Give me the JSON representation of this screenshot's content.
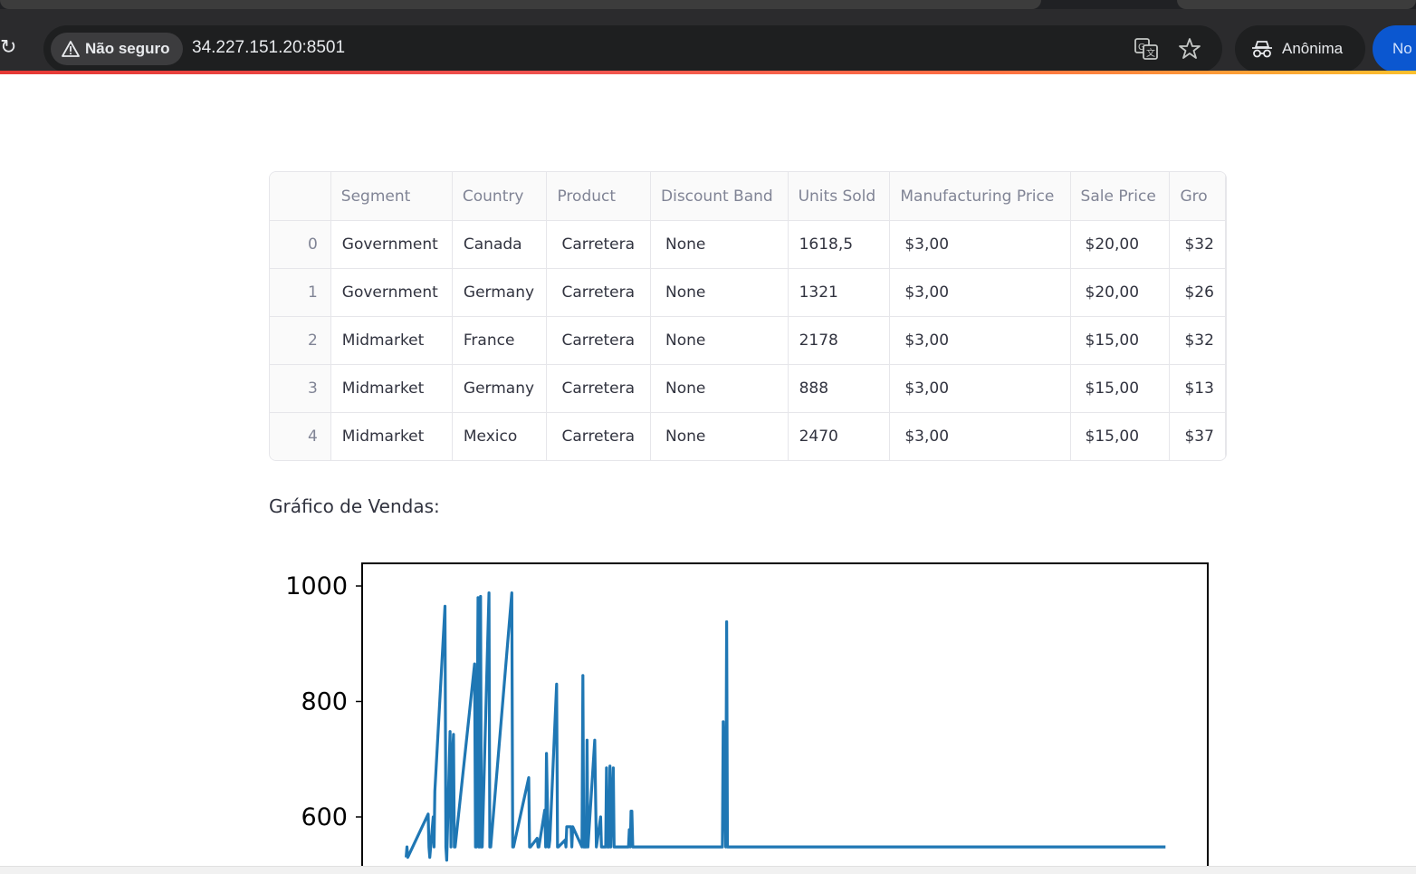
{
  "browser": {
    "security_label": "Não seguro",
    "url": "34.227.151.20:8501",
    "profile_label": "Anônima",
    "new_button_label": "No"
  },
  "table": {
    "columns": [
      "",
      "Segment",
      "Country",
      "Product",
      "Discount Band",
      "Units Sold",
      "Manufacturing Price",
      "Sale Price",
      "Gro"
    ],
    "rows": [
      [
        "0",
        "Government",
        "Canada",
        "Carretera",
        "None",
        "1618,5",
        "$3,00",
        "$20,00",
        "$32"
      ],
      [
        "1",
        "Government",
        "Germany",
        "Carretera",
        "None",
        "1321",
        "$3,00",
        "$20,00",
        "$26"
      ],
      [
        "2",
        "Midmarket",
        "France",
        "Carretera",
        "None",
        "2178",
        "$3,00",
        "$15,00",
        "$32"
      ],
      [
        "3",
        "Midmarket",
        "Germany",
        "Carretera",
        "None",
        "888",
        "$3,00",
        "$15,00",
        "$13"
      ],
      [
        "4",
        "Midmarket",
        "Mexico",
        "Carretera",
        "None",
        "2470",
        "$3,00",
        "$15,00",
        "$37"
      ]
    ]
  },
  "chart_caption": "Gráfico de Vendas:",
  "chart_data": {
    "type": "line",
    "color": "#1f77b4",
    "yticks": [
      600,
      800,
      1000
    ],
    "ylim_visible": [
      548,
      1038
    ],
    "xlim": [
      0,
      100
    ],
    "x": [
      5.2,
      5.3,
      5.4,
      7.8,
      7.9,
      8.0,
      8.4,
      8.5,
      8.6,
      9.8,
      9.9,
      10.0,
      10.4,
      10.5,
      10.6,
      10.8,
      10.9,
      11.0,
      13.3,
      13.4,
      13.5,
      13.7,
      13.8,
      13.9,
      14.0,
      14.1,
      14.2,
      15.0,
      15.1,
      15.2,
      17.7,
      17.8,
      17.9,
      19.7,
      19.8,
      19.9,
      20.7,
      20.8,
      20.9,
      21.6,
      21.7,
      21.8,
      22.0,
      22.1,
      22.2,
      23.0,
      23.1,
      23.2,
      24.0,
      24.1,
      24.2,
      24.7,
      24.8,
      24.9,
      26.0,
      26.1,
      26.2,
      26.5,
      26.6,
      26.7,
      27.5,
      27.6,
      27.7,
      28.2,
      28.3,
      28.4,
      28.8,
      28.9,
      29.0,
      29.2,
      29.3,
      29.4,
      29.7,
      29.8,
      29.9,
      31.5,
      31.6,
      31.7,
      31.8,
      31.9,
      32.0,
      32.1,
      32.2,
      32.3,
      32.4,
      32.5,
      32.6,
      42.5,
      42.6,
      42.7,
      43.0,
      43.1,
      43.2,
      43.3,
      43.4,
      43.5,
      43.6,
      43.7,
      43.8,
      46.0,
      46.1,
      46.2,
      46.3,
      46.4,
      46.5,
      50.8,
      50.9,
      51.0,
      53.2,
      53.3,
      53.4,
      53.7,
      53.8,
      53.9,
      55.5,
      55.6,
      55.7,
      56.2,
      56.3,
      56.4,
      58.0,
      58.1,
      58.2,
      60.0,
      60.1,
      60.2,
      62.0,
      62.1,
      62.2,
      63.6,
      63.7,
      63.8,
      65.0,
      65.1,
      65.2,
      66.5,
      66.6,
      66.7,
      67.2,
      67.3,
      67.4,
      67.7,
      67.8,
      67.9,
      69.3,
      69.4,
      69.5,
      70.8,
      70.9,
      71.0,
      75.1,
      75.2,
      75.3,
      76.0,
      76.1,
      76.2,
      79.0,
      79.1,
      79.2,
      80.4,
      80.5,
      80.6,
      81.6,
      81.7,
      81.8,
      82.1,
      82.2,
      82.3,
      86.7,
      86.8,
      86.9,
      88.2,
      88.3,
      88.4,
      88.6,
      88.7,
      88.8,
      89.0,
      89.1,
      89.2,
      91.8,
      91.9,
      92.0,
      92.5,
      92.6,
      92.7,
      93.3,
      93.4,
      93.5,
      94.8,
      94.9,
      95.0
    ],
    "y": [
      530,
      548,
      530,
      605,
      548,
      530,
      600,
      548,
      645,
      965,
      548,
      525,
      748,
      548,
      685,
      743,
      548,
      548,
      865,
      548,
      548,
      980,
      548,
      548,
      982,
      548,
      548,
      988,
      548,
      548,
      988,
      548,
      548,
      668,
      548,
      548,
      563,
      548,
      548,
      612,
      548,
      710,
      548,
      548,
      560,
      830,
      548,
      548,
      560,
      548,
      583,
      583,
      548,
      583,
      548,
      845,
      548,
      548,
      733,
      548,
      733,
      640,
      548,
      600,
      548,
      548,
      548,
      685,
      548,
      548,
      688,
      548,
      685,
      548,
      548,
      548,
      578,
      548,
      610,
      610,
      548,
      548,
      548,
      548,
      548,
      548,
      548,
      548,
      548,
      765,
      548,
      938,
      548,
      548,
      548,
      548,
      548,
      548,
      548,
      548,
      548,
      548,
      548,
      548,
      548,
      548,
      548,
      548,
      548,
      548,
      548,
      548,
      548,
      548,
      548,
      548,
      548,
      548,
      548,
      548,
      548,
      548,
      548,
      548,
      548,
      548,
      548,
      548,
      548,
      548,
      548,
      548,
      548,
      548,
      548,
      548,
      548,
      548,
      548,
      548,
      548,
      548,
      548,
      548,
      548,
      548,
      548,
      548,
      548,
      548,
      548,
      548,
      548,
      548,
      548,
      548,
      548,
      548,
      548,
      548,
      548,
      548,
      548,
      548,
      548,
      548,
      548,
      548,
      548,
      548,
      548,
      548,
      548,
      548,
      548,
      548,
      548,
      548,
      548,
      548,
      548,
      548,
      548,
      548,
      548,
      548,
      548,
      548,
      548,
      548,
      548,
      548,
      548,
      548,
      548,
      548,
      548,
      548,
      548,
      548,
      548
    ]
  }
}
